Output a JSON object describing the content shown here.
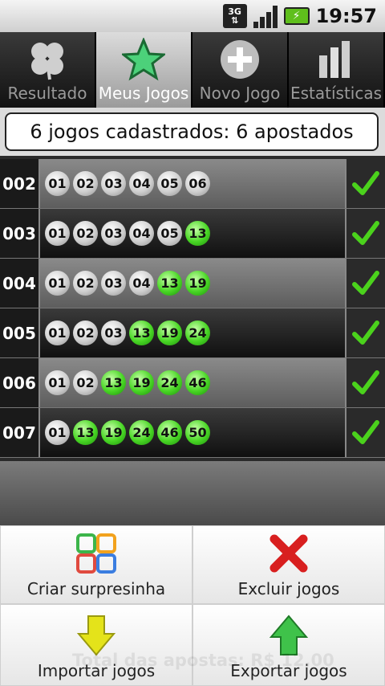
{
  "status": {
    "network": "3G",
    "time": "19:57"
  },
  "tabs": [
    {
      "label": "Resultado",
      "icon": "clover-icon",
      "active": false
    },
    {
      "label": "Meus Jogos",
      "icon": "star-icon",
      "active": true
    },
    {
      "label": "Novo Jogo",
      "icon": "plus-icon",
      "active": false
    },
    {
      "label": "Estatísticas",
      "icon": "bar-chart-icon",
      "active": false
    }
  ],
  "summary": "6 jogos cadastrados: 6 apostados",
  "games": [
    {
      "id": "002",
      "numbers": [
        "01",
        "02",
        "03",
        "04",
        "05",
        "06"
      ],
      "hits": []
    },
    {
      "id": "003",
      "numbers": [
        "01",
        "02",
        "03",
        "04",
        "05",
        "13"
      ],
      "hits": [
        "13"
      ]
    },
    {
      "id": "004",
      "numbers": [
        "01",
        "02",
        "03",
        "04",
        "13",
        "19"
      ],
      "hits": [
        "13",
        "19"
      ]
    },
    {
      "id": "005",
      "numbers": [
        "01",
        "02",
        "03",
        "13",
        "19",
        "24"
      ],
      "hits": [
        "13",
        "19",
        "24"
      ]
    },
    {
      "id": "006",
      "numbers": [
        "01",
        "02",
        "13",
        "19",
        "24",
        "46"
      ],
      "hits": [
        "13",
        "19",
        "24",
        "46"
      ]
    },
    {
      "id": "007",
      "numbers": [
        "01",
        "13",
        "19",
        "24",
        "46",
        "50"
      ],
      "hits": [
        "13",
        "19",
        "24",
        "46",
        "50"
      ]
    }
  ],
  "menu": [
    {
      "label": "Criar surpresinha",
      "icon": "grid-numbers-icon",
      "name": "create-surprise-button"
    },
    {
      "label": "Excluir jogos",
      "icon": "red-x-icon",
      "name": "delete-games-button"
    },
    {
      "label": "Importar jogos",
      "icon": "arrow-down-icon",
      "name": "import-games-button"
    },
    {
      "label": "Exportar jogos",
      "icon": "arrow-up-icon",
      "name": "export-games-button"
    }
  ],
  "total_label": "Total das apostas: R$ 12,00",
  "colors": {
    "hit": "#48d624",
    "check": "#4bd21c",
    "delete": "#e02020"
  }
}
